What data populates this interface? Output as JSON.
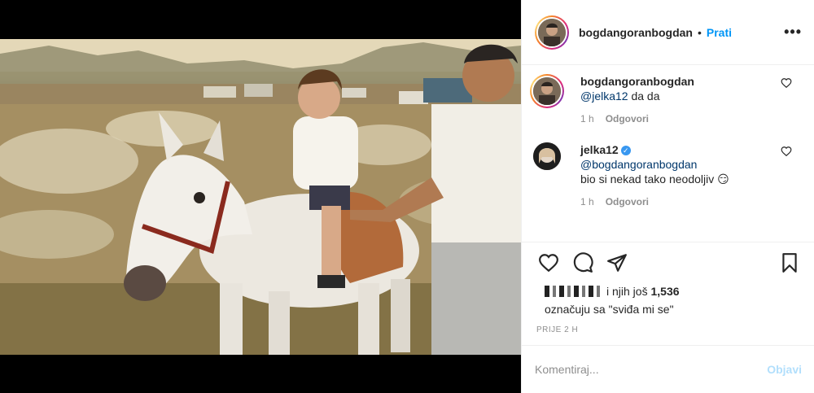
{
  "post": {
    "username": "bogdangoranbogdan",
    "separator": "•",
    "follow_label": "Prati",
    "more_label": "•••",
    "photo_alt": ""
  },
  "comments": [
    {
      "username": "bogdangoranbogdan",
      "mention": "@jelka12",
      "text": " da da",
      "time": "1 h",
      "reply_label": "Odgovori"
    },
    {
      "username": "jelka12",
      "verified": "✓",
      "mention": "@bogdangoranbogdan",
      "text": "bio si nekad tako neodoljiv 😏",
      "time": "1 h",
      "reply_label": "Odgovori"
    }
  ],
  "likes": {
    "prefix": "i njih još",
    "count": "1,536",
    "suffix": "označuju sa \"sviđa mi se\""
  },
  "timestamp": "PRIJE 2 H",
  "add_comment": {
    "placeholder": "Komentiraj...",
    "post_label": "Objavi"
  },
  "icons": {
    "like": "heart-icon",
    "comment": "comment-icon",
    "share": "paper-plane-icon",
    "save": "bookmark-icon",
    "comment_like": "heart-icon"
  },
  "colors": {
    "accent": "#0095f6",
    "post_disabled": "#b2dffc",
    "muted": "#8e8e8e",
    "text": "#262626"
  }
}
